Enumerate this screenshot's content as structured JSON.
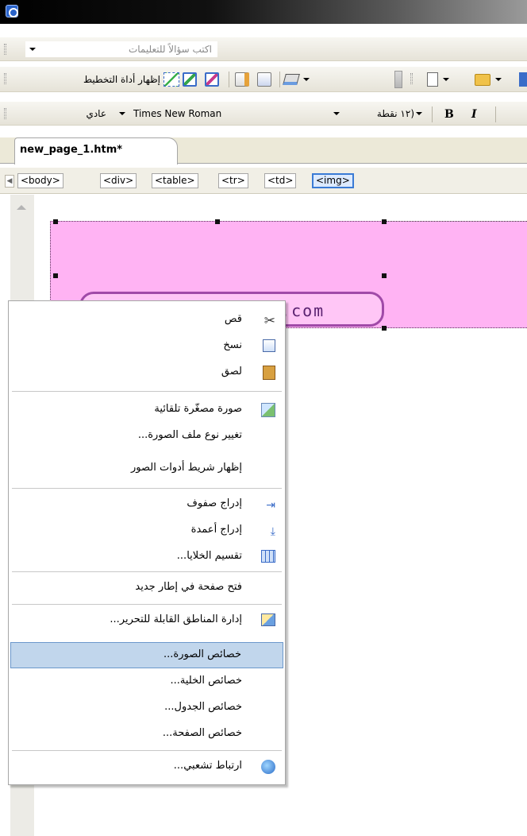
{
  "help": {
    "placeholder": "اكتب سؤالاً للتعليمات"
  },
  "picture_toolbar": {
    "layout_tool_label": "إظهار أداة التخطيط"
  },
  "format_toolbar": {
    "style_value": "عادي",
    "font_value": "Times New Roman",
    "size_value": "(١٢ نقطة",
    "bold_label": "B",
    "italic_label": "I"
  },
  "tabs": [
    {
      "label": "new_page_1.htm*"
    }
  ],
  "quick_tags": [
    "<body>",
    "<div>",
    "<table>",
    "<tr>",
    "<td>",
    "<img>"
  ],
  "page": {
    "url_text": "e.com",
    "pink_color": "#ffb3f3"
  },
  "context_menu": {
    "items": [
      {
        "label": "قص",
        "icon": "scissors-icon"
      },
      {
        "label": "نسخ",
        "icon": "copy-icon"
      },
      {
        "label": "لصق",
        "icon": "paste-icon"
      },
      {
        "label": "صورة مصغّرة تلقائية",
        "icon": "thumbnail-icon"
      },
      {
        "label": "تغيير نوع ملف الصورة...",
        "icon": ""
      },
      {
        "label": "إظهار شريط أدوات الصور",
        "icon": ""
      },
      {
        "label": "إدراج صفوف",
        "icon": "insert-rows-icon"
      },
      {
        "label": "إدراج أعمدة",
        "icon": "insert-columns-icon"
      },
      {
        "label": "تقسيم الخلايا...",
        "icon": "split-cells-icon"
      },
      {
        "label": "فتح صفحة في إطار جديد",
        "icon": ""
      },
      {
        "label": "إدارة المناطق القابلة للتحرير...",
        "icon": "editable-regions-icon"
      },
      {
        "label": "خصائص الصورة...",
        "icon": ""
      },
      {
        "label": "خصائص الخلية...",
        "icon": ""
      },
      {
        "label": "خصائص الجدول...",
        "icon": ""
      },
      {
        "label": "خصائص الصفحة...",
        "icon": ""
      },
      {
        "label": "ارتباط تشعبي...",
        "icon": "hyperlink-icon"
      }
    ],
    "highlighted_index": 11
  }
}
